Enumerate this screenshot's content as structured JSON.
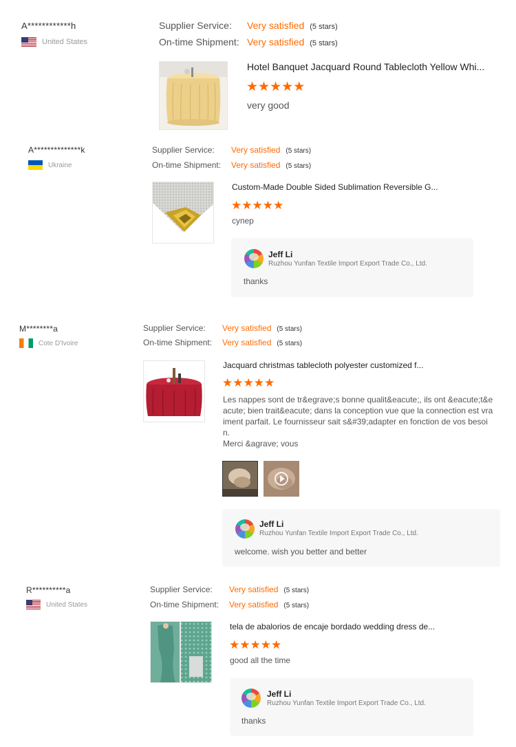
{
  "labels": {
    "supplier_service": "Supplier Service:",
    "ontime_shipment": "On-time Shipment:"
  },
  "colors": {
    "accent": "#ff6a00",
    "reply_bg": "#f7f7f8"
  },
  "reviews": [
    {
      "user": "A************h",
      "country": "United States",
      "flag": "us-flag-icon",
      "supplier_service": "Very satisfied",
      "supplier_service_stars": "(5 stars)",
      "ontime_shipment": "Very satisfied",
      "ontime_shipment_stars": "(5 stars)",
      "product_title": "Hotel Banquet Jacquard Round Tablecloth Yellow Whi...",
      "rating": 5,
      "comment": "very good"
    },
    {
      "user": "A**************k",
      "country": "Ukraine",
      "flag": "ua-flag-icon",
      "supplier_service": "Very satisfied",
      "supplier_service_stars": "(5 stars)",
      "ontime_shipment": "Very satisfied",
      "ontime_shipment_stars": "(5 stars)",
      "product_title": "Custom-Made Double Sided Sublimation Reversible G...",
      "rating": 5,
      "comment": "супер",
      "reply": {
        "name": "Jeff Li",
        "company": "Ruzhou Yunfan Textile Import Export Trade Co., Ltd.",
        "text": "thanks"
      }
    },
    {
      "user": "M********a",
      "country": "Cote D'Ivoire",
      "flag": "ci-flag-icon",
      "supplier_service": "Very satisfied",
      "supplier_service_stars": "(5 stars)",
      "ontime_shipment": "Very satisfied",
      "ontime_shipment_stars": "(5 stars)",
      "product_title": "Jacquard christmas tablecloth polyester customized f...",
      "rating": 5,
      "comment_lines": [
        "Les nappes sont de tr&egrave;s bonne qualit&eacute;, ils ont &eacute;t&e",
        "acute; bien trait&eacute; dans la conception vue que la connection est vra",
        "iment parfait. Le fournisseur sait s&#39;adapter en fonction de vos besoi",
        "n.",
        "Merci &agrave; vous"
      ],
      "media": [
        "photo-thumbnail",
        "video-thumbnail"
      ],
      "reply": {
        "name": "Jeff Li",
        "company": "Ruzhou Yunfan Textile Import Export Trade Co., Ltd.",
        "text": "welcome. wish you better and better"
      }
    },
    {
      "user": "R**********a",
      "country": "United States",
      "flag": "us-flag-icon",
      "supplier_service": "Very satisfied",
      "supplier_service_stars": "(5 stars)",
      "ontime_shipment": "Very satisfied",
      "ontime_shipment_stars": "(5 stars)",
      "product_title": "tela de abalorios de encaje bordado wedding dress de...",
      "rating": 5,
      "comment": "good all the time",
      "reply": {
        "name": "Jeff Li",
        "company": "Ruzhou Yunfan Textile Import Export Trade Co., Ltd.",
        "text": "thanks"
      }
    }
  ]
}
